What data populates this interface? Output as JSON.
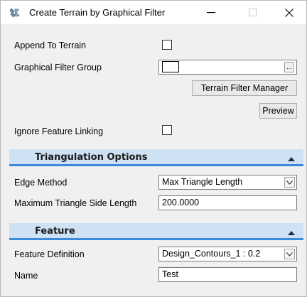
{
  "window": {
    "title": "Create Terrain by Graphical Filter",
    "minimize_glyph": "—",
    "maximize_glyph": "☐",
    "close_glyph": "✕"
  },
  "general": {
    "append_to_terrain_label": "Append To Terrain",
    "append_to_terrain_checked": false,
    "graphical_filter_group_label": "Graphical Filter Group",
    "graphical_filter_group_value": "",
    "ellipsis_label": "...",
    "terrain_filter_manager_label": "Terrain Filter Manager",
    "preview_label": "Preview",
    "ignore_feature_linking_label": "Ignore Feature Linking",
    "ignore_feature_linking_checked": false
  },
  "triangulation": {
    "section_title": "Triangulation Options",
    "edge_method_label": "Edge Method",
    "edge_method_value": "Max Triangle Length",
    "max_side_length_label": "Maximum Triangle Side Length",
    "max_side_length_value": "200.0000"
  },
  "feature": {
    "section_title": "Feature",
    "feature_definition_label": "Feature Definition",
    "feature_definition_value": "Design_Contours_1 : 0.2",
    "name_label": "Name",
    "name_value": "Test"
  },
  "colors": {
    "section_header_bg": "#cfe2f5",
    "section_header_accent": "#3d8ad8",
    "window_bg": "#f0f0f0"
  },
  "icons": {
    "app": "terrain-filter-icon",
    "collapse": "caret-up-icon",
    "dropdown": "chevron-down-icon"
  }
}
